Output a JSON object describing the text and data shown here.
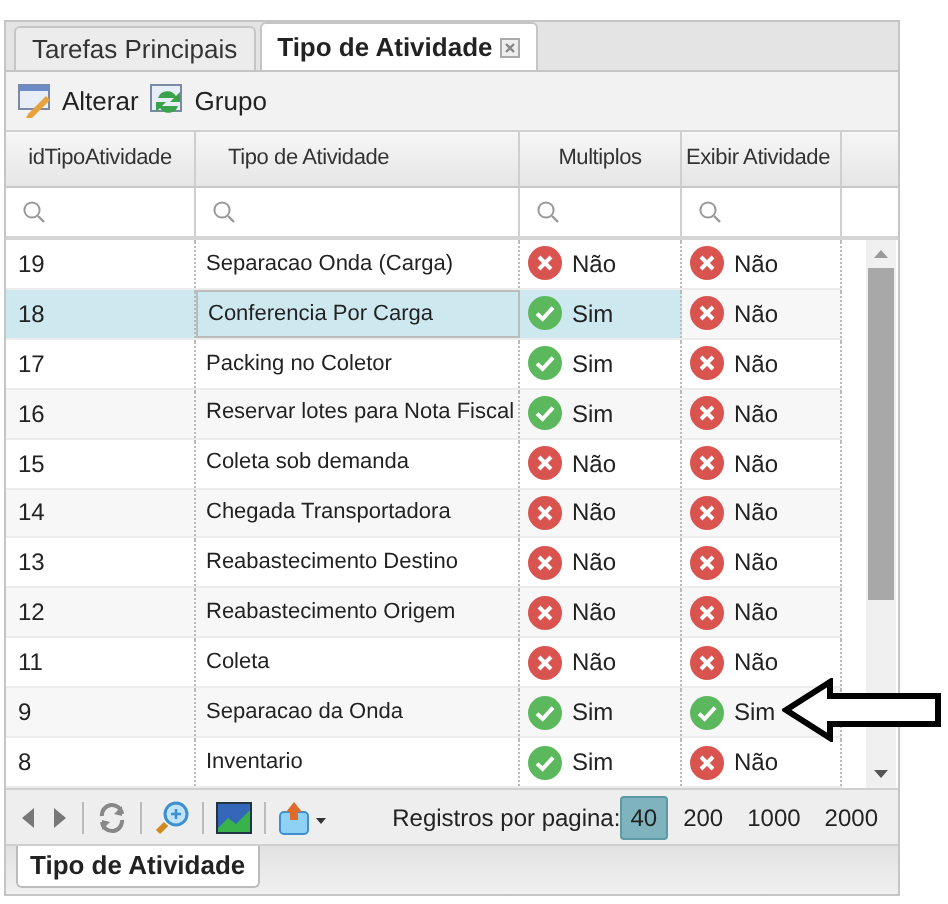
{
  "tabs": [
    {
      "label": "Tarefas Principais",
      "selected": false,
      "closable": false
    },
    {
      "label": "Tipo de Atividade",
      "selected": true,
      "closable": true
    }
  ],
  "toolbar": [
    {
      "label": "Alterar",
      "kind": "edit"
    },
    {
      "label": "Grupo",
      "kind": "group"
    }
  ],
  "table": {
    "columns": [
      "idTipoAtividade",
      "Tipo de Atividade",
      "Multiplos",
      "Exibir Atividade"
    ],
    "rows": [
      {
        "id": "19",
        "name": "Separacao Onda (Carga)",
        "multiplos": {
          "on": false,
          "text": "Não"
        },
        "exibir": {
          "on": false,
          "text": "Não"
        },
        "selected": false
      },
      {
        "id": "18",
        "name": "Conferencia Por Carga",
        "multiplos": {
          "on": true,
          "text": "Sim"
        },
        "exibir": {
          "on": false,
          "text": "Não"
        },
        "selected": true
      },
      {
        "id": "17",
        "name": "Packing no Coletor",
        "multiplos": {
          "on": true,
          "text": "Sim"
        },
        "exibir": {
          "on": false,
          "text": "Não"
        },
        "selected": false
      },
      {
        "id": "16",
        "name": "Reservar lotes para Nota Fiscal",
        "multiplos": {
          "on": true,
          "text": "Sim"
        },
        "exibir": {
          "on": false,
          "text": "Não"
        },
        "selected": false
      },
      {
        "id": "15",
        "name": "Coleta sob demanda",
        "multiplos": {
          "on": false,
          "text": "Não"
        },
        "exibir": {
          "on": false,
          "text": "Não"
        },
        "selected": false
      },
      {
        "id": "14",
        "name": "Chegada Transportadora",
        "multiplos": {
          "on": false,
          "text": "Não"
        },
        "exibir": {
          "on": false,
          "text": "Não"
        },
        "selected": false
      },
      {
        "id": "13",
        "name": "Reabastecimento Destino",
        "multiplos": {
          "on": false,
          "text": "Não"
        },
        "exibir": {
          "on": false,
          "text": "Não"
        },
        "selected": false
      },
      {
        "id": "12",
        "name": "Reabastecimento Origem",
        "multiplos": {
          "on": false,
          "text": "Não"
        },
        "exibir": {
          "on": false,
          "text": "Não"
        },
        "selected": false
      },
      {
        "id": "11",
        "name": "Coleta",
        "multiplos": {
          "on": false,
          "text": "Não"
        },
        "exibir": {
          "on": false,
          "text": "Não"
        },
        "selected": false
      },
      {
        "id": "9",
        "name": "Separacao da Onda",
        "multiplos": {
          "on": true,
          "text": "Sim"
        },
        "exibir": {
          "on": true,
          "text": "Sim"
        },
        "selected": false
      },
      {
        "id": "8",
        "name": "Inventario",
        "multiplos": {
          "on": true,
          "text": "Sim"
        },
        "exibir": {
          "on": false,
          "text": "Não"
        },
        "selected": false
      }
    ]
  },
  "pager": {
    "label": "Registros por pagina:",
    "sizes": [
      {
        "label": "40",
        "selected": true
      },
      {
        "label": "200",
        "selected": false
      },
      {
        "label": "1000",
        "selected": false
      },
      {
        "label": "2000",
        "selected": false
      }
    ]
  },
  "bottom_tabs": [
    {
      "label": "Tipo de Atividade",
      "selected": true
    }
  ]
}
